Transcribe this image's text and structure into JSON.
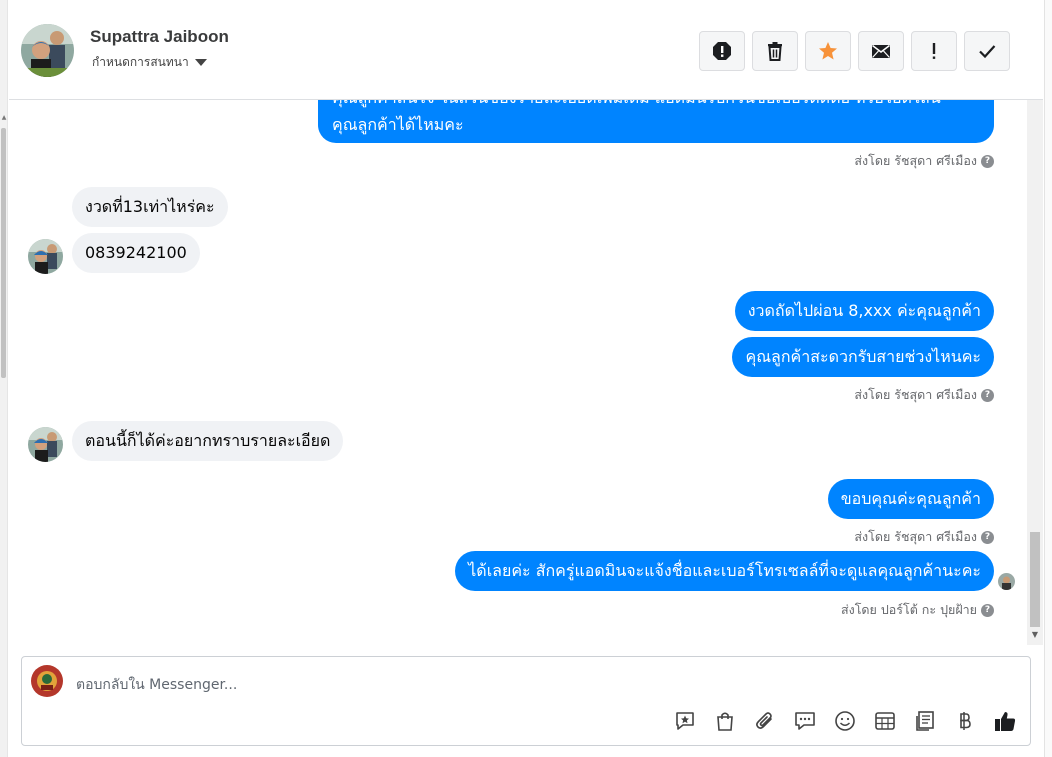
{
  "header": {
    "name": "Supattra Jaiboon",
    "assign_label": "กำหนดการสนทนา",
    "toolbar": [
      {
        "name": "spam-button",
        "icon": "alert-octagon-icon"
      },
      {
        "name": "delete-button",
        "icon": "trash-icon"
      },
      {
        "name": "star-button",
        "icon": "star-icon"
      },
      {
        "name": "mark-unread-button",
        "icon": "envelope-icon"
      },
      {
        "name": "follow-up-button",
        "icon": "exclamation-icon"
      },
      {
        "name": "done-button",
        "icon": "check-icon"
      }
    ]
  },
  "messages": {
    "m0_line1": "คุณลูกค้าสนใจ ในส่วนของรายละเอียดเพิ่มเติม แอดมินรบกวนขอเบอร์ติดต่อ หรือไอดีไลน์",
    "m0_line2": "คุณลูกค้าได้ไหมคะ",
    "sent_by_1": "ส่งโดย รัชสุดา ศรีเมือง",
    "m1": "งวดที่13เท่าไหร่คะ",
    "m2": "0839242100",
    "m3": "งวดถัดไปผ่อน 8,xxx ค่ะคุณลูกค้า",
    "m4": "คุณลูกค้าสะดวกรับสายช่วงไหนคะ",
    "sent_by_2": "ส่งโดย รัชสุดา ศรีเมือง",
    "m5": "ตอนนี้ก็ได้ค่ะอยากทราบรายละเอียด",
    "m6": "ขอบคุณค่ะคุณลูกค้า",
    "sent_by_3": "ส่งโดย รัชสุดา ศรีเมือง",
    "m7": "ได้เลยค่ะ สักครู่แอดมินจะแจ้งชื่อและเบอร์โทรเซลล์ที่จะดูแลคุณลูกค้านะคะ",
    "sent_by_4": "ส่งโดย ปอร์โต้ กะ ปุยฝ้าย",
    "help_glyph": "?"
  },
  "reply": {
    "placeholder": "ตอบกลับใน Messenger..."
  },
  "colors": {
    "outgoing": "#0084ff",
    "incoming": "#f0f2f5",
    "star": "#f7923a"
  },
  "reply_icons": [
    "saved-reply-icon",
    "shop-icon",
    "attachment-icon",
    "chat-bubble-icon",
    "emoji-icon",
    "table-icon",
    "document-icon",
    "baht-icon",
    "thumbs-up-icon"
  ]
}
